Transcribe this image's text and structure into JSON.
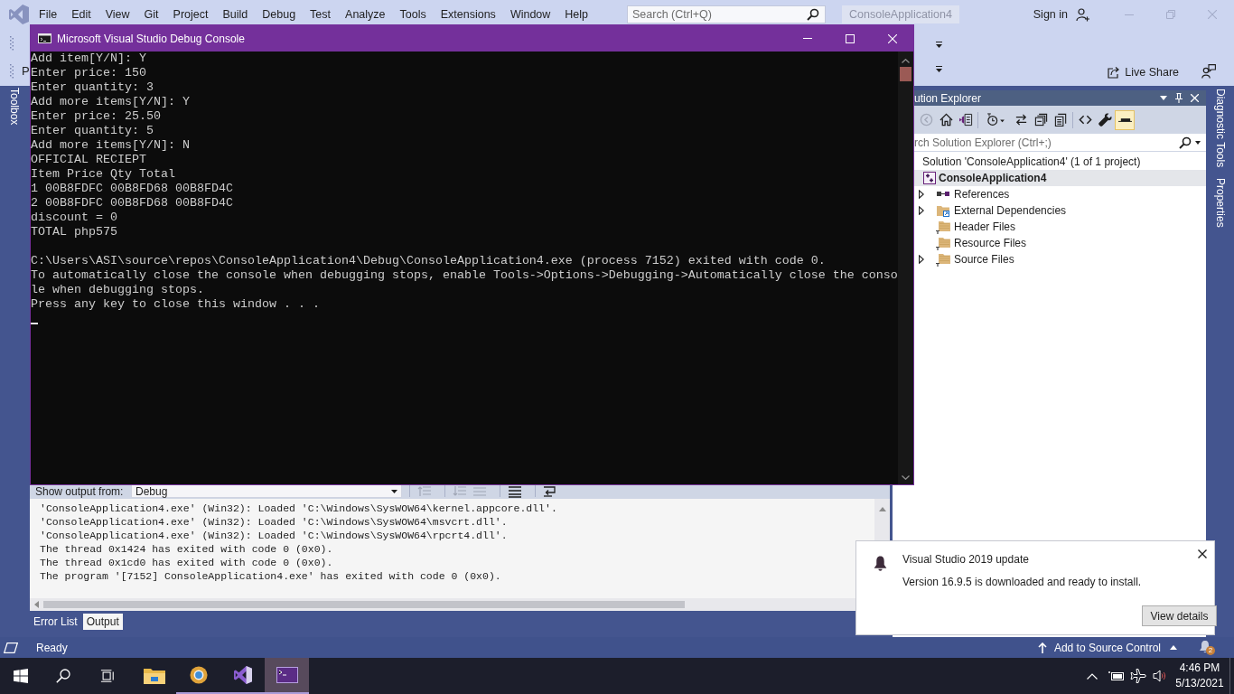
{
  "menubar": {
    "items": [
      "File",
      "Edit",
      "View",
      "Git",
      "Project",
      "Build",
      "Debug",
      "Test",
      "Analyze",
      "Tools",
      "Extensions",
      "Window",
      "Help"
    ],
    "search": {
      "placeholder": "Search (Ctrl+Q)"
    },
    "solution_name": "ConsoleApplication4",
    "sign_in": "Sign in"
  },
  "toolbar": {
    "cut_label": "P",
    "live_share": "Live Share"
  },
  "toolbox_tab": "Toolbox",
  "console": {
    "title": "Microsoft Visual Studio Debug Console",
    "paragraphs": [
      [
        "Add item[Y/N]: Y",
        "Enter price: 150",
        "Enter quantity: 3",
        "Add more items[Y/N]: Y",
        "Enter price: 25.50",
        "Enter quantity: 5",
        "Add more items[Y/N]: N",
        "OFFICIAL RECIEPT",
        "Item Price Qty Total",
        "1 00B8FDFC 00B8FD68 00B8FD4C",
        "2 00B8FDFC 00B8FD68 00B8FD4C",
        "discount = 0",
        "TOTAL php575"
      ],
      [
        "C:\\Users\\ASI\\source\\repos\\ConsoleApplication4\\Debug\\ConsoleApplication4.exe (process 7152) exited with code 0.",
        "To automatically close the console when debugging stops, enable Tools->Options->Debugging->Automatically close the conso",
        "le when debugging stops.",
        "Press any key to close this window . . ."
      ]
    ]
  },
  "output": {
    "show_output_from": "Show output from:",
    "source": "Debug",
    "toolbar_groups": [
      [
        {
          "kind": "up",
          "disabled": true
        }
      ],
      [
        {
          "kind": "down",
          "disabled": true
        },
        {
          "kind": "find",
          "disabled": true
        }
      ],
      [
        {
          "kind": "clear",
          "disabled": false
        }
      ],
      [
        {
          "kind": "wrap",
          "disabled": false
        }
      ]
    ],
    "lines": [
      "'ConsoleApplication4.exe' (Win32): Loaded 'C:\\Windows\\SysWOW64\\kernel.appcore.dll'.",
      "'ConsoleApplication4.exe' (Win32): Loaded 'C:\\Windows\\SysWOW64\\msvcrt.dll'.",
      "'ConsoleApplication4.exe' (Win32): Loaded 'C:\\Windows\\SysWOW64\\rpcrt4.dll'.",
      "The thread 0x1424 has exited with code 0 (0x0).",
      "The thread 0x1cd0 has exited with code 0 (0x0).",
      "The program '[7152] ConsoleApplication4.exe' has exited with code 0 (0x0)."
    ],
    "tabs": [
      {
        "label": "Error List",
        "selected": false
      },
      {
        "label": "Output",
        "selected": true
      }
    ]
  },
  "solution_explorer": {
    "title": "ution Explorer",
    "toolbar_groups": [
      [
        {
          "kind": "back",
          "disabled": true,
          "pressed": false
        },
        {
          "kind": "home",
          "disabled": false,
          "pressed": false
        },
        {
          "kind": "views",
          "disabled": false,
          "pressed": false
        }
      ],
      [
        {
          "kind": "history",
          "disabled": false,
          "pressed": false
        },
        {
          "kind": "sync",
          "disabled": false,
          "pressed": false
        },
        {
          "kind": "collapse",
          "disabled": false,
          "pressed": false
        },
        {
          "kind": "files",
          "disabled": false,
          "pressed": false
        }
      ],
      [
        {
          "kind": "code",
          "disabled": false,
          "pressed": false
        },
        {
          "kind": "properties",
          "disabled": false,
          "pressed": false
        },
        {
          "kind": "preview",
          "disabled": false,
          "pressed": true
        }
      ]
    ],
    "search": {
      "placeholder": "rch Solution Explorer (Ctrl+;)"
    },
    "tree": [
      {
        "label": "Solution 'ConsoleApplication4' (1 of 1 project)",
        "selected": false,
        "children": [
          {
            "kind": "project",
            "label": "ConsoleApplication4",
            "selected": true,
            "children": [
              {
                "kind": "references",
                "label": "References",
                "selected": false,
                "expandable": true
              },
              {
                "kind": "dependencies",
                "label": "External Dependencies",
                "selected": false,
                "expandable": true
              },
              {
                "kind": "filter",
                "label": "Header Files",
                "selected": false,
                "expandable": false
              },
              {
                "kind": "filter",
                "label": "Resource Files",
                "selected": false,
                "expandable": false
              },
              {
                "kind": "filter",
                "label": "Source Files",
                "selected": false,
                "expandable": true
              }
            ]
          }
        ]
      }
    ]
  },
  "side_tabs": [
    "Diagnostic Tools",
    "Properties"
  ],
  "notification": {
    "title": "Visual Studio 2019 update",
    "message": "Version 16.9.5 is downloaded and ready to install.",
    "button": "View details"
  },
  "status_bar": {
    "text": "Ready",
    "source_control": "Add to Source Control",
    "notification_count": "2"
  },
  "taskbar": {
    "buttons": [
      {
        "kind": "start"
      },
      {
        "kind": "search"
      },
      {
        "kind": "task-view"
      }
    ],
    "apps": [
      {
        "kind": "folder",
        "running": false,
        "active": false
      },
      {
        "kind": "browser",
        "running": true,
        "active": false
      },
      {
        "kind": "ide",
        "running": true,
        "active": false
      },
      {
        "kind": "console",
        "running": true,
        "active": true
      }
    ],
    "time": "4:46 PM",
    "date": "5/13/2021"
  }
}
